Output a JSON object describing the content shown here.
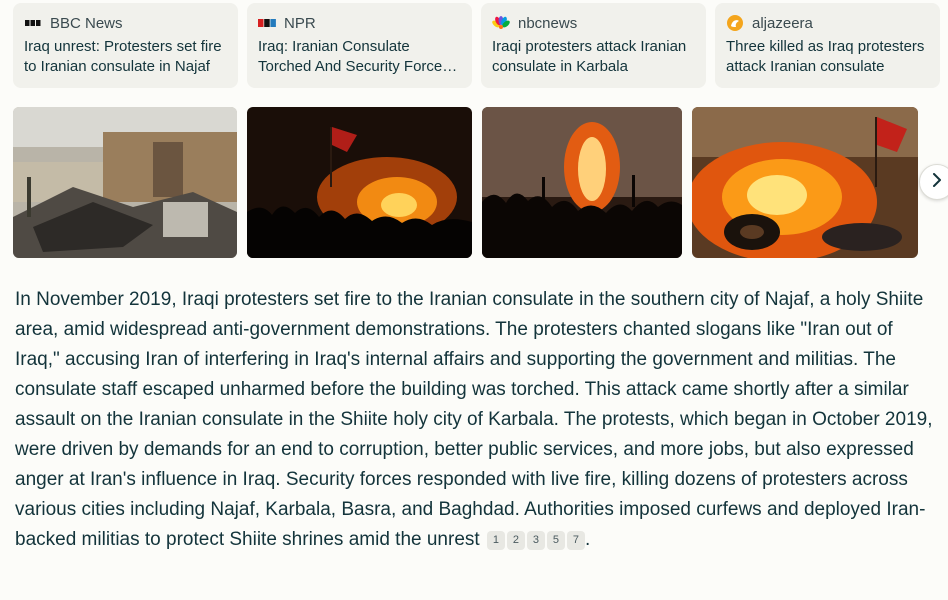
{
  "sources": [
    {
      "icon": "bbc-logo-icon",
      "name": "BBC News",
      "title": "Iraq unrest: Protesters set fire to Iranian consulate in Najaf"
    },
    {
      "icon": "npr-logo-icon",
      "name": "NPR",
      "title": "Iraq: Iranian Consulate Torched And Security Forces Kill Protesters"
    },
    {
      "icon": "nbc-peacock-icon",
      "name": "nbcnews",
      "title": "Iraqi protesters attack Iranian consulate in Karbala"
    },
    {
      "icon": "aljazeera-logo-icon",
      "name": "aljazeera",
      "title": "Three killed as Iraq protesters attack Iranian consulate"
    }
  ],
  "images": [
    {
      "scene": "damaged-consulate-debris"
    },
    {
      "scene": "protesters-fire-night-flag"
    },
    {
      "scene": "protesters-silhouettes-fire"
    },
    {
      "scene": "burning-tires-flag"
    }
  ],
  "carousel": {
    "next_icon": "chevron-right-icon"
  },
  "answer": {
    "text": "In November 2019, Iraqi protesters set fire to the Iranian consulate in the southern city of Najaf, a holy Shiite area, amid widespread anti-government demonstrations. The protesters chanted slogans like \"Iran out of Iraq,\" accusing Iran of interfering in Iraq's internal affairs and supporting the government and militias. The consulate staff escaped unharmed before the building was torched. This attack came shortly after a similar assault on the Iranian consulate in the Shiite holy city of Karbala. The protests, which began in October 2019, were driven by demands for an end to corruption, better public services, and more jobs, but also expressed anger at Iran's influence in Iraq. Security forces responded with live fire, killing dozens of protesters across various cities including Najaf, Karbala, Basra, and Baghdad. Authorities imposed curfews and deployed Iran-backed militias to protect Shiite shrines amid the unrest",
    "citations": [
      "1",
      "2",
      "3",
      "5",
      "7"
    ],
    "end": "."
  },
  "colors": {
    "card_bg": "#f1f1ec",
    "page_bg": "#fcfcf9",
    "text": "#13343b",
    "cite_bg": "#e8e8e3"
  }
}
